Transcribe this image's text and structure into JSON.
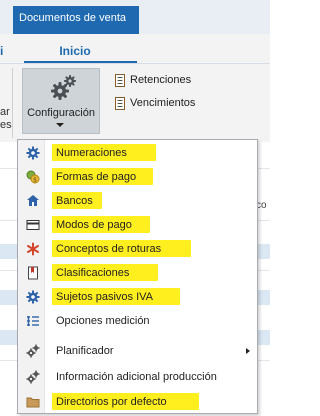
{
  "window": {
    "doc_tab": "Documentos de venta"
  },
  "ribbon": {
    "active_tab": "Inicio",
    "left_fragments": {
      "digit": "i",
      "line1": "ar",
      "line2": "es"
    },
    "config_button": {
      "label": "Configuración",
      "icon": "gears-icon"
    },
    "small_buttons": [
      {
        "label": "Retenciones",
        "icon": "document-list-icon"
      },
      {
        "label": "Vencimientos",
        "icon": "document-list-icon"
      }
    ]
  },
  "background": {
    "right_fragment": "co"
  },
  "menu": {
    "items": [
      {
        "label": "Numeraciones",
        "icon": "gear-icon",
        "highlighted": true
      },
      {
        "label": "Formas de pago",
        "icon": "coins-icon",
        "highlighted": true
      },
      {
        "label": "Bancos",
        "icon": "bank-icon",
        "highlighted": true
      },
      {
        "label": "Modos de pago",
        "icon": "card-icon",
        "highlighted": true
      },
      {
        "label": "Conceptos de roturas",
        "icon": "asterisk-icon",
        "highlighted": true
      },
      {
        "label": "Clasificaciones",
        "icon": "bookmark-icon",
        "highlighted": true
      },
      {
        "label": "Sujetos pasivos IVA",
        "icon": "gear-icon",
        "highlighted": true
      },
      {
        "label": "Opciones medición",
        "icon": "measure-list-icon",
        "highlighted": false
      },
      {
        "label": "Planificador",
        "icon": "gears-icon",
        "highlighted": false,
        "submenu": true
      },
      {
        "label": "Información adicional producción",
        "icon": "gears-icon",
        "highlighted": false
      },
      {
        "label": "Directorios por defecto",
        "icon": "folder-icon",
        "highlighted": true
      }
    ],
    "highlight_color": "#ffef1f",
    "accent_color": "#1e69b0"
  }
}
